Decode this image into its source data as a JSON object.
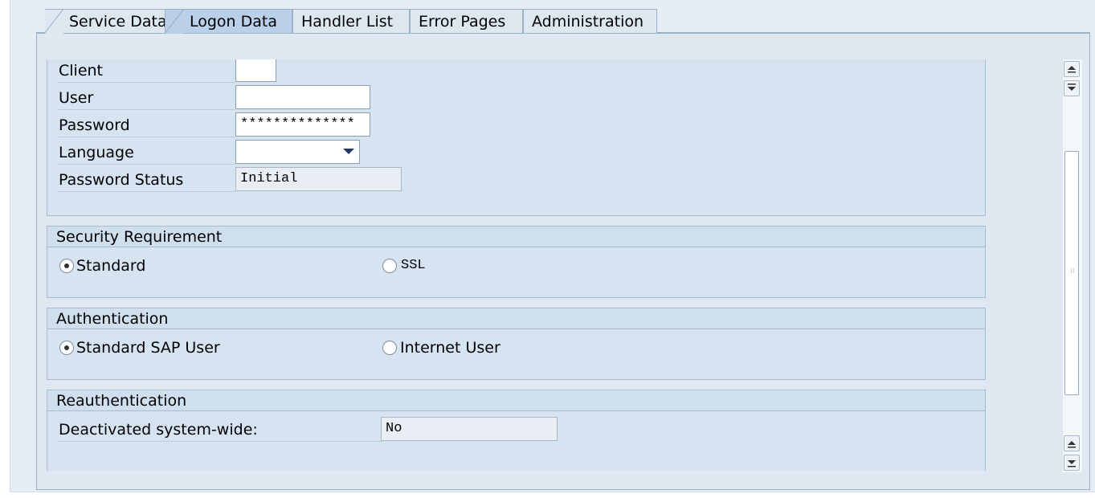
{
  "tabs": [
    {
      "label": "Service Data"
    },
    {
      "label": "Logon Data"
    },
    {
      "label": "Handler List"
    },
    {
      "label": "Error Pages"
    },
    {
      "label": "Administration"
    }
  ],
  "active_tab": "Logon Data",
  "logon": {
    "client_label": "Client",
    "client_value": "",
    "user_label": "User",
    "user_value": "",
    "password_label": "Password",
    "password_value": "**************",
    "language_label": "Language",
    "language_value": "",
    "password_status_label": "Password Status",
    "password_status_value": "Initial"
  },
  "security": {
    "title": "Security Requirement",
    "option_standard": "Standard",
    "option_ssl": "SSL",
    "selected": "Standard"
  },
  "authentication": {
    "title": "Authentication",
    "option_sap": "Standard SAP User",
    "option_internet": "Internet User",
    "selected": "Standard SAP User"
  },
  "reauthentication": {
    "title": "Reauthentication",
    "deactivated_label": "Deactivated system-wide:",
    "deactivated_value": "No"
  },
  "icons": {
    "scroll_up": "triangle-up-icon",
    "scroll_down": "triangle-down-icon",
    "dropdown": "chevron-down-icon"
  }
}
